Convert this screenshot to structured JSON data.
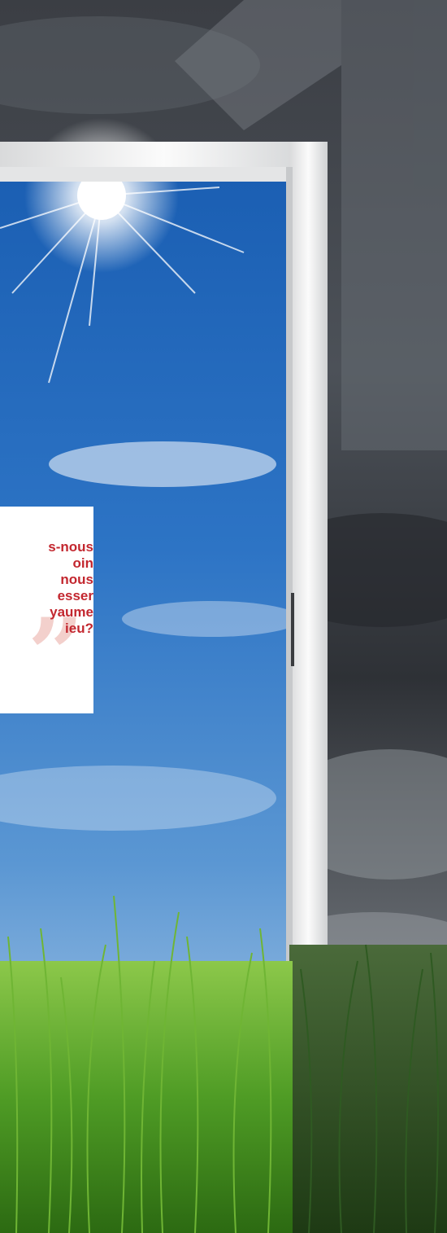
{
  "quote": {
    "lines": [
      "s-nous",
      "oin",
      "nous",
      "esser",
      "yaume",
      "ieu?"
    ],
    "mark": "”"
  },
  "colors": {
    "quote_text": "#c3272f",
    "quote_mark": "#f3d0cc",
    "storm_sky": "#3a3d42",
    "clear_sky": "#2f6fbf",
    "grass": "#5aa82a",
    "door_frame": "#f2f2f2"
  },
  "icons": {
    "sun": "sun-icon",
    "numeral": "numeral-one-shape"
  }
}
